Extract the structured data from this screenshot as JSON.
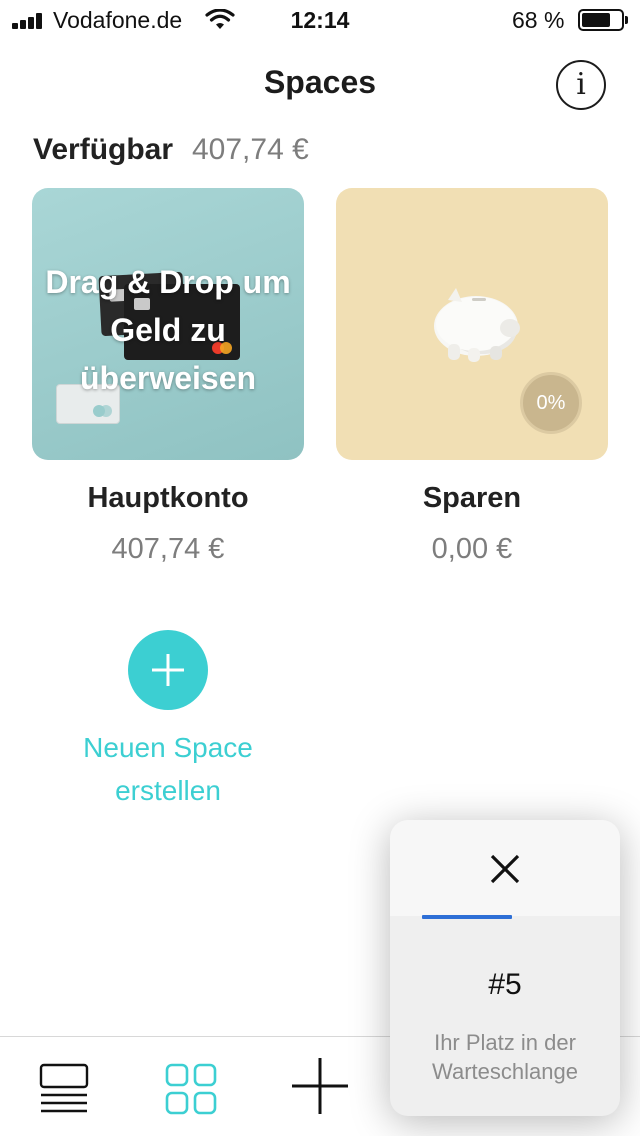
{
  "status_bar": {
    "carrier": "Vodafone.de",
    "time": "12:14",
    "battery_percent": "68 %",
    "battery_level": 0.68,
    "icons": [
      "signal-icon",
      "wifi-icon",
      "battery-icon"
    ]
  },
  "header": {
    "title": "Spaces",
    "info_label": "i"
  },
  "balance": {
    "label": "Verfügbar",
    "amount": "407,74 €"
  },
  "spaces": [
    {
      "name": "Hauptkonto",
      "amount": "407,74 €",
      "overlay_text": "Drag & Drop um Geld zu überweisen",
      "image": "bank-cards-image"
    },
    {
      "name": "Sparen",
      "amount": "0,00 €",
      "badge": "0%",
      "image": "piggy-bank-image"
    }
  ],
  "new_space": {
    "label": "Neuen Space erstellen",
    "icon": "plus-icon"
  },
  "tab_bar": {
    "items": [
      {
        "icon": "transactions-list-icon",
        "active": false
      },
      {
        "icon": "spaces-grid-icon",
        "active": true
      },
      {
        "icon": "plus-icon",
        "active": false
      }
    ]
  },
  "waitlist_popup": {
    "close_icon": "close-icon",
    "rank": "#5",
    "text": "Ihr Platz in der Warteschlange"
  },
  "colors": {
    "accent": "#3ccfd2",
    "main_card": "#a9d6d6",
    "savings_card": "#f1dfb4",
    "popup_indicator": "#2e6fd6"
  }
}
